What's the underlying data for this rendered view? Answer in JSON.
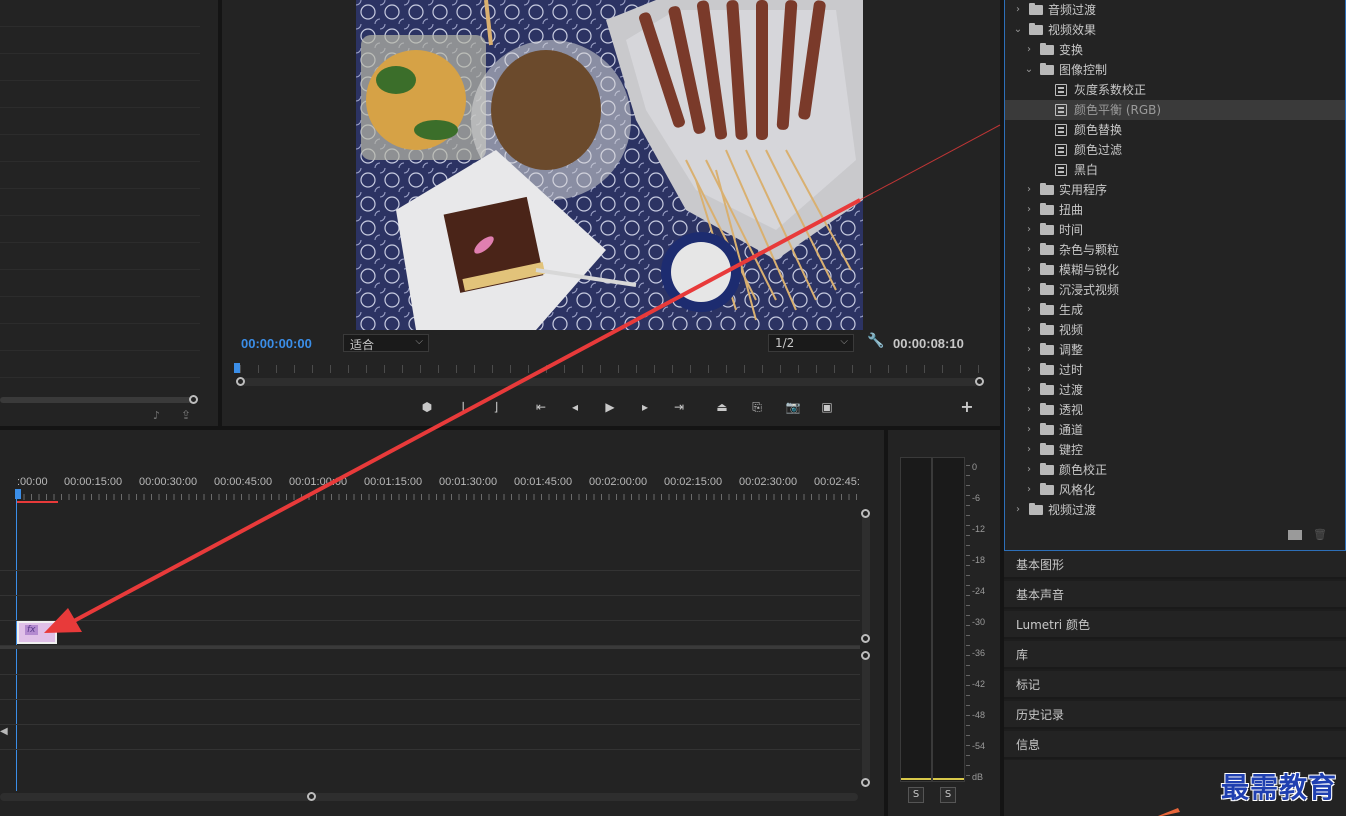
{
  "program_monitor": {
    "current_time": "00:00:00:00",
    "zoom_select": "适合",
    "resolution_select": "1/2",
    "duration": "00:00:08:10"
  },
  "effects_tree": [
    {
      "label": "音频过渡",
      "type": "folder",
      "level": 0,
      "expanded": false
    },
    {
      "label": "视频效果",
      "type": "folder",
      "level": 0,
      "expanded": true
    },
    {
      "label": "变换",
      "type": "folder",
      "level": 1,
      "expanded": false
    },
    {
      "label": "图像控制",
      "type": "folder",
      "level": 1,
      "expanded": true
    },
    {
      "label": "灰度系数校正",
      "type": "effect",
      "level": 2
    },
    {
      "label": "颜色平衡 (RGB)",
      "type": "effect",
      "level": 2,
      "selected": true
    },
    {
      "label": "颜色替换",
      "type": "effect",
      "level": 2
    },
    {
      "label": "颜色过滤",
      "type": "effect",
      "level": 2
    },
    {
      "label": "黑白",
      "type": "effect",
      "level": 2
    },
    {
      "label": "实用程序",
      "type": "folder",
      "level": 1,
      "expanded": false
    },
    {
      "label": "扭曲",
      "type": "folder",
      "level": 1,
      "expanded": false
    },
    {
      "label": "时间",
      "type": "folder",
      "level": 1,
      "expanded": false
    },
    {
      "label": "杂色与颗粒",
      "type": "folder",
      "level": 1,
      "expanded": false
    },
    {
      "label": "模糊与锐化",
      "type": "folder",
      "level": 1,
      "expanded": false
    },
    {
      "label": "沉浸式视频",
      "type": "folder",
      "level": 1,
      "expanded": false
    },
    {
      "label": "生成",
      "type": "folder",
      "level": 1,
      "expanded": false
    },
    {
      "label": "视频",
      "type": "folder",
      "level": 1,
      "expanded": false
    },
    {
      "label": "调整",
      "type": "folder",
      "level": 1,
      "expanded": false
    },
    {
      "label": "过时",
      "type": "folder",
      "level": 1,
      "expanded": false
    },
    {
      "label": "过渡",
      "type": "folder",
      "level": 1,
      "expanded": false
    },
    {
      "label": "透视",
      "type": "folder",
      "level": 1,
      "expanded": false
    },
    {
      "label": "通道",
      "type": "folder",
      "level": 1,
      "expanded": false
    },
    {
      "label": "键控",
      "type": "folder",
      "level": 1,
      "expanded": false
    },
    {
      "label": "颜色校正",
      "type": "folder",
      "level": 1,
      "expanded": false
    },
    {
      "label": "风格化",
      "type": "folder",
      "level": 1,
      "expanded": false
    },
    {
      "label": "视频过渡",
      "type": "folder",
      "level": 0,
      "expanded": false
    }
  ],
  "side_panels": [
    "基本图形",
    "基本声音",
    "Lumetri 颜色",
    "库",
    "标记",
    "历史记录",
    "信息"
  ],
  "timeline": {
    "ruler_labels": [
      ":00:00",
      "00:00:15:00",
      "00:00:30:00",
      "00:00:45:00",
      "00:01:00:00",
      "00:01:15:00",
      "00:01:30:00",
      "00:01:45:00",
      "00:02:00:00",
      "00:02:15:00",
      "00:02:30:00",
      "00:02:45:"
    ],
    "clip_label": "fx"
  },
  "audio_meter": {
    "scale": [
      "0",
      "-6",
      "-12",
      "-18",
      "-24",
      "-30",
      "-36",
      "-42",
      "-48",
      "-54",
      "dB"
    ],
    "solo_labels": [
      "S",
      "S"
    ]
  },
  "watermark": "最需教育",
  "colors": {
    "accent": "#3b8ee8",
    "arrow": "#e83a3a",
    "panel_border": "#2d6fb8"
  }
}
